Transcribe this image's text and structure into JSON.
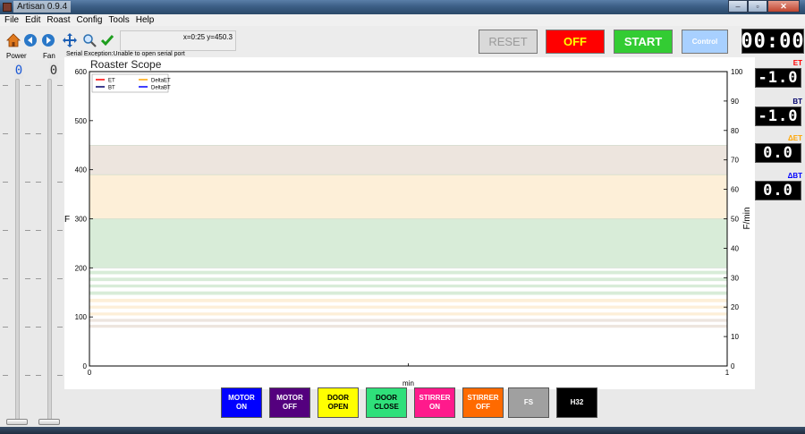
{
  "window": {
    "title": "Artisan 0.9.4",
    "controls": [
      "–",
      "▫",
      "✕"
    ]
  },
  "menu": [
    "File",
    "Edit",
    "Roast",
    "Config",
    "Tools",
    "Help"
  ],
  "toolbar": {
    "icons": [
      "home-icon",
      "back-icon",
      "forward-icon",
      "pan-icon",
      "zoom-icon",
      "check-icon"
    ],
    "coordinates": "x=0:25 y=450.3",
    "reset_label": "RESET",
    "off_label": "OFF",
    "start_label": "START",
    "control_label": "Control",
    "timer": "00:00"
  },
  "sliders": {
    "power_label": "Power",
    "fan_label": "Fan",
    "power_value": "0",
    "fan_value": "0"
  },
  "status": {
    "serial_message": "Serial Exception:Unable to open serial port"
  },
  "chart_data": {
    "type": "line",
    "title": "Roaster Scope",
    "xlabel": "min",
    "ylabel": "F",
    "ylabel_right": "F/min",
    "xlim": [
      0,
      1
    ],
    "ylim": [
      0,
      600
    ],
    "ylim_right": [
      0,
      100
    ],
    "x_ticks": [
      "0",
      "1"
    ],
    "y_ticks": [
      "0",
      "100",
      "200",
      "300",
      "400",
      "500",
      "600"
    ],
    "y_ticks_right": [
      "0",
      "10",
      "20",
      "30",
      "40",
      "50",
      "60",
      "70",
      "80",
      "90",
      "100"
    ],
    "legend": {
      "placement": "top-left",
      "entries": [
        {
          "name": "ET",
          "color": "#ff0000"
        },
        {
          "name": "BT",
          "color": "#00006b"
        },
        {
          "name": "DeltaET",
          "color": "#ffa500"
        },
        {
          "name": "DeltaBT",
          "color": "#0000ff"
        }
      ]
    },
    "series": [
      {
        "name": "ET",
        "values": []
      },
      {
        "name": "BT",
        "values": []
      },
      {
        "name": "DeltaET",
        "values": []
      },
      {
        "name": "DeltaBT",
        "values": []
      }
    ],
    "phase_bands": [
      {
        "from": 390,
        "to": 450,
        "color": "#ede5de"
      },
      {
        "from": 300,
        "to": 390,
        "color": "#fdefd8"
      },
      {
        "from": 200,
        "to": 300,
        "color": "#d8ecd8"
      }
    ],
    "stripes": [
      {
        "from": 187,
        "to": 194,
        "color": "#d8ecd8"
      },
      {
        "from": 173,
        "to": 180,
        "color": "#d8ecd8"
      },
      {
        "from": 160,
        "to": 166,
        "color": "#d8ecd8"
      },
      {
        "from": 145,
        "to": 152,
        "color": "#d8ecd8"
      },
      {
        "from": 130,
        "to": 137,
        "color": "#fdefd8"
      },
      {
        "from": 117,
        "to": 123,
        "color": "#fdefd8"
      },
      {
        "from": 103,
        "to": 109,
        "color": "#fdefd8"
      },
      {
        "from": 90,
        "to": 96,
        "color": "#ede5de"
      },
      {
        "from": 78,
        "to": 84,
        "color": "#ede5de"
      }
    ]
  },
  "readouts": [
    {
      "label": "ET",
      "value": "-1.0",
      "color": "#ff0000"
    },
    {
      "label": "BT",
      "value": "-1.0",
      "color": "#00006b"
    },
    {
      "label": "ΔET",
      "value": "0.0",
      "color": "#ffa500"
    },
    {
      "label": "ΔBT",
      "value": "0.0",
      "color": "#0000ff"
    }
  ],
  "event_buttons": [
    {
      "line1": "MOTOR",
      "line2": "ON",
      "color": "#0000ff"
    },
    {
      "line1": "MOTOR",
      "line2": "OFF",
      "color": "#54007e"
    },
    {
      "line1": "DOOR",
      "line2": "OPEN",
      "color": "#ffff00",
      "text_color": "#000000"
    },
    {
      "line1": "DOOR",
      "line2": "CLOSE",
      "color": "#2fe07a",
      "text_color": "#000000"
    },
    {
      "line1": "STIRRER",
      "line2": "ON",
      "color": "#ff1a8c"
    },
    {
      "line1": "STIRRER",
      "line2": "OFF",
      "color": "#ff6a00"
    },
    {
      "line1": "FS",
      "line2": "",
      "color": "#a0a0a0"
    },
    {
      "line1": "H32",
      "line2": "",
      "color": "#000000"
    }
  ]
}
